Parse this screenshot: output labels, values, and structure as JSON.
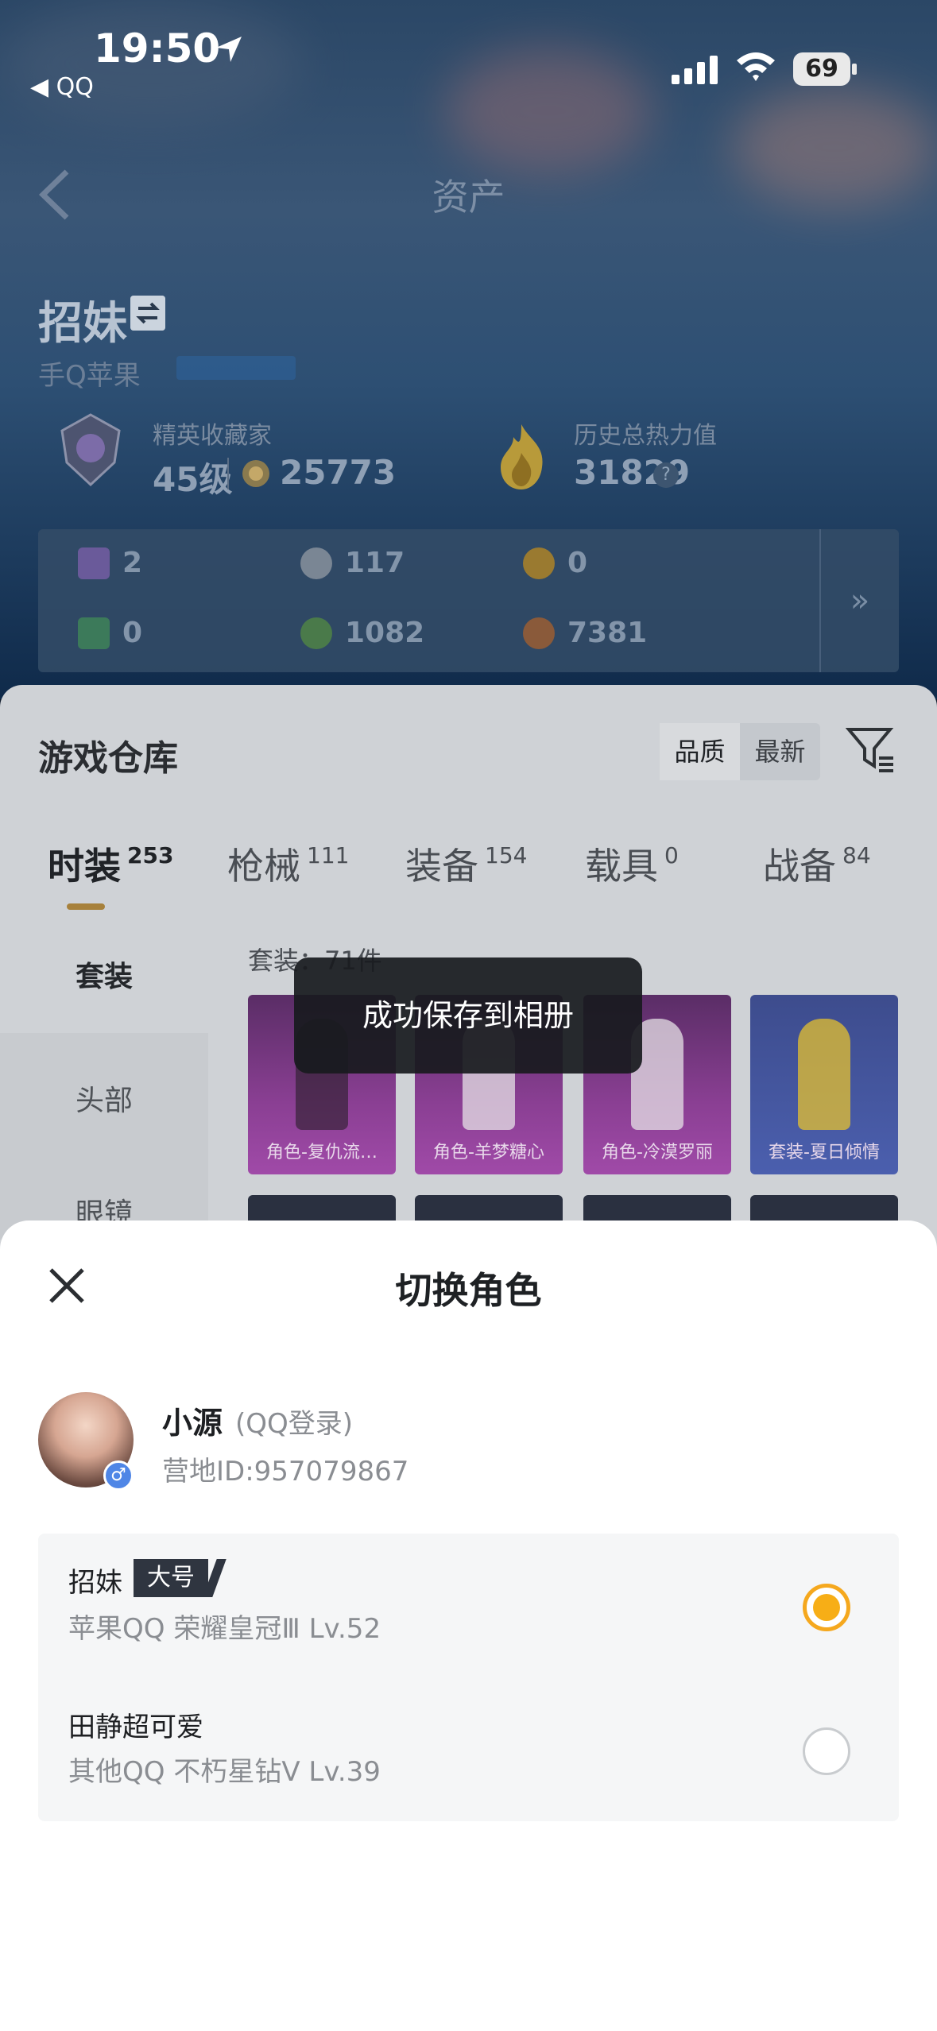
{
  "status_bar": {
    "time": "19:50",
    "back_app": "◀ QQ",
    "battery": "69"
  },
  "nav": {
    "title": "资产"
  },
  "profile": {
    "name": "招妹",
    "platform": "手Q苹果",
    "collector_title": "精英收藏家",
    "level": "45级",
    "coins": "25773",
    "heat_label": "历史总热力值",
    "heat_value": "31829",
    "help": "?"
  },
  "currencies": [
    {
      "value": "2",
      "color": "#6a5a9a"
    },
    {
      "value": "117",
      "color": "#7a8694"
    },
    {
      "value": "0",
      "color": "#9a7a30"
    },
    {
      "value": "0",
      "color": "#3c7a5a"
    },
    {
      "value": "1082",
      "color": "#4a7a4a"
    },
    {
      "value": "7381",
      "color": "#8a5a3a"
    }
  ],
  "currency_more": "»",
  "warehouse": {
    "title": "游戏仓库",
    "sort_options": [
      "品质",
      "最新"
    ],
    "categories": [
      {
        "label": "时装",
        "count": "253"
      },
      {
        "label": "枪械",
        "count": "111"
      },
      {
        "label": "装备",
        "count": "154"
      },
      {
        "label": "载具",
        "count": "0"
      },
      {
        "label": "战备",
        "count": "84"
      }
    ],
    "side_items": [
      "套装",
      "头部",
      "眼镜"
    ],
    "suit_count": "套装：71件",
    "items": [
      {
        "label": "角色-复仇流…"
      },
      {
        "label": "角色-羊梦糖心"
      },
      {
        "label": "角色-冷漠罗丽"
      },
      {
        "label": "套装-夏日倾情"
      }
    ]
  },
  "toast": "成功保存到相册",
  "sheet": {
    "title": "切换角色",
    "user": {
      "name": "小源",
      "login": "(QQ登录)",
      "id": "营地ID:957079867",
      "gender": "♂"
    },
    "roles": [
      {
        "name": "招妹",
        "badge": "大号",
        "info": "苹果QQ   荣耀皇冠Ⅲ   Lv.52",
        "selected": true
      },
      {
        "name": "田静超可爱",
        "badge": "",
        "info": "其他QQ   不朽星钻Ⅴ   Lv.39",
        "selected": false
      }
    ]
  }
}
